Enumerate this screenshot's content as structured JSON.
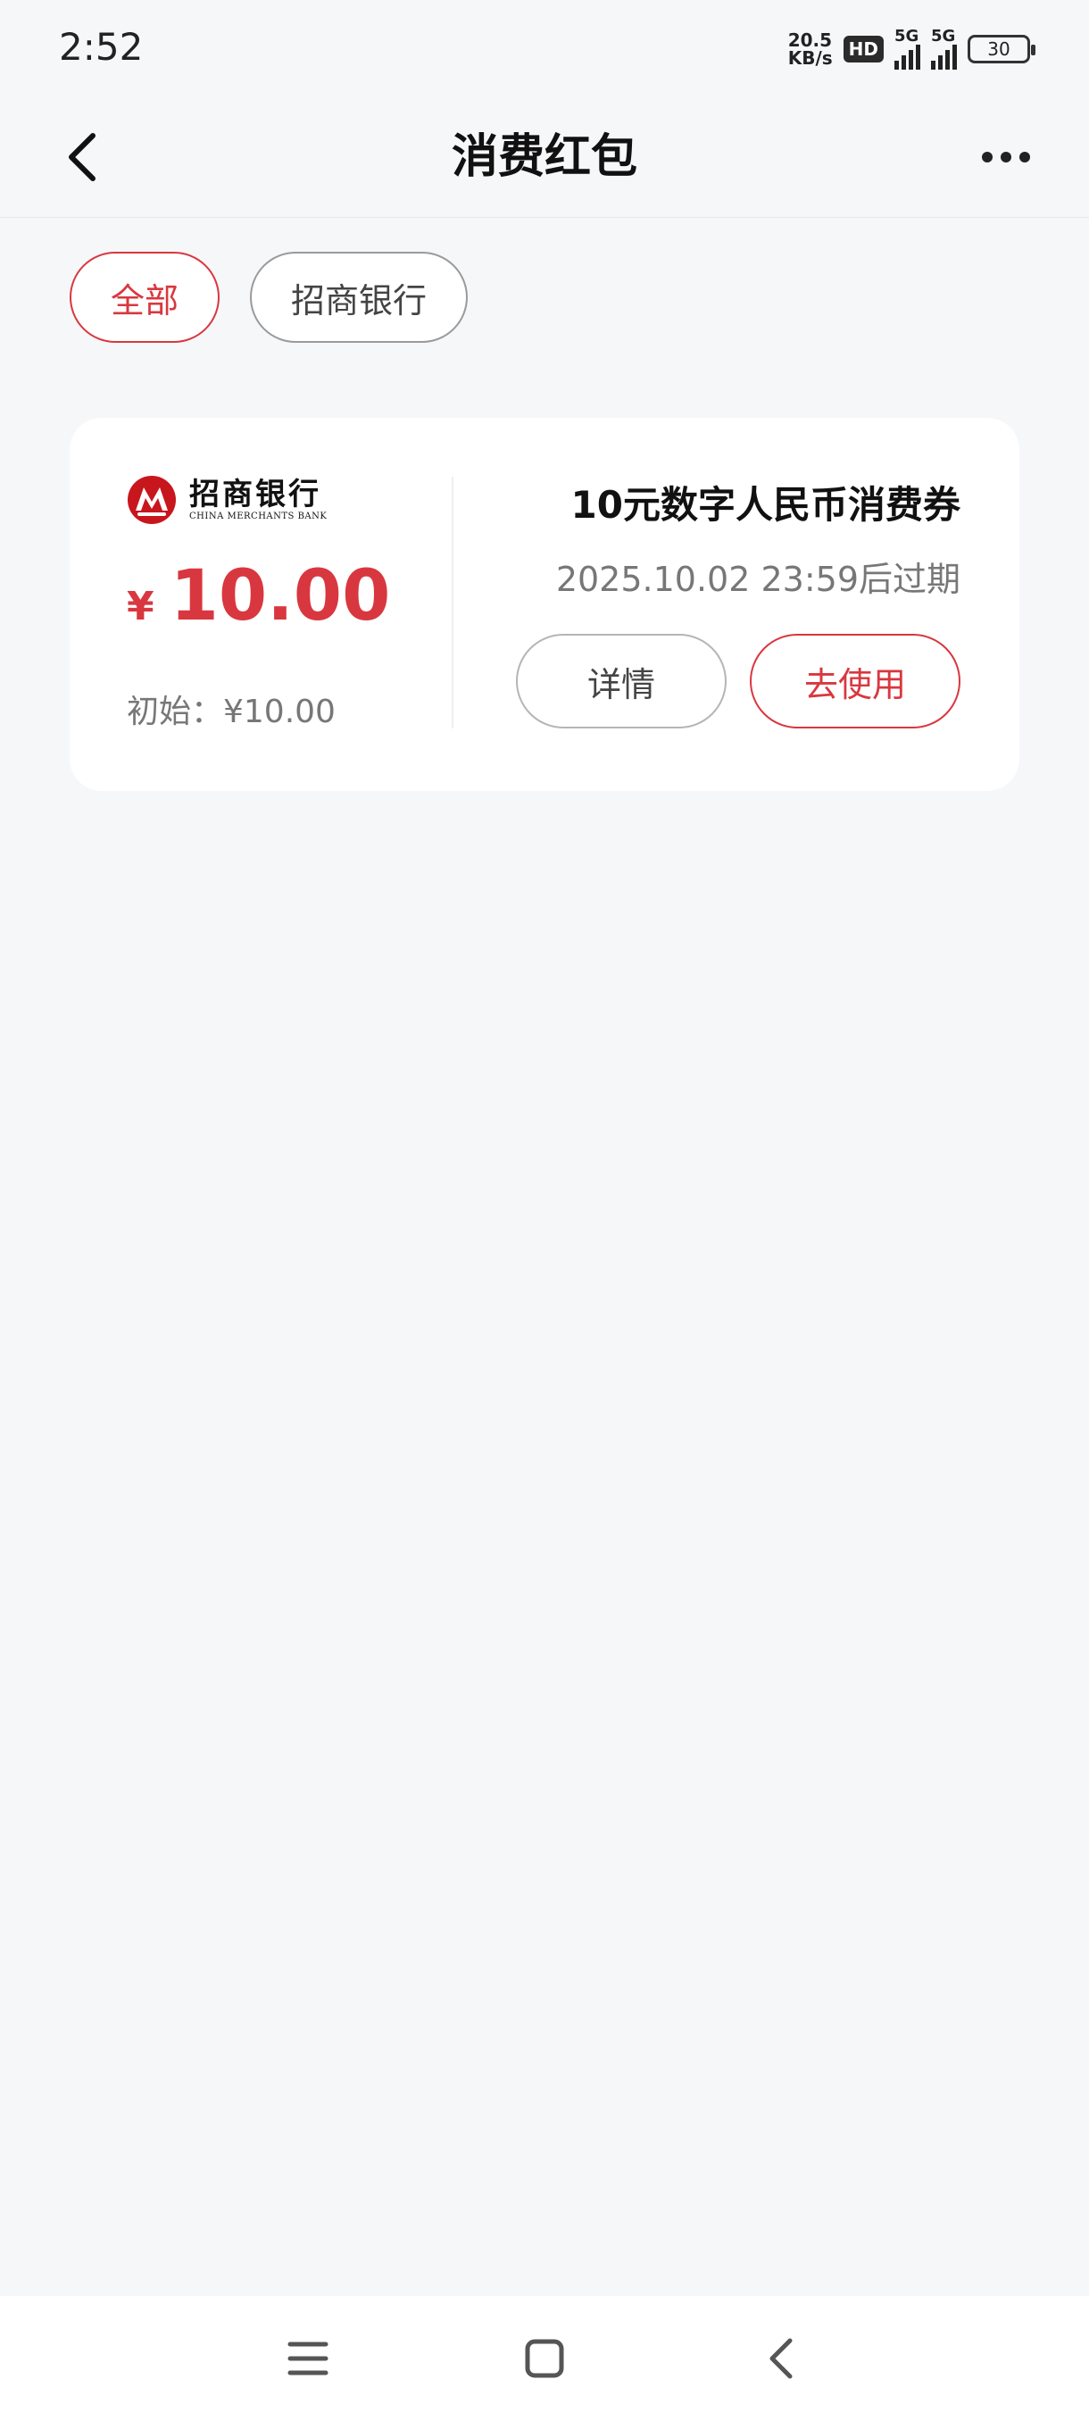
{
  "status_bar": {
    "time": "2:52",
    "net_speed_value": "20.5",
    "net_speed_unit": "KB/s",
    "hd_label": "HD",
    "signal1_label": "5G",
    "signal2_label": "5G",
    "battery_level": "30"
  },
  "header": {
    "title": "消费红包",
    "back_icon": "chevron-left-icon",
    "more_icon": "more-horizontal-icon"
  },
  "filters": [
    {
      "label": "全部",
      "active": true
    },
    {
      "label": "招商银行",
      "active": false
    }
  ],
  "coupon": {
    "bank_name": "招商银行",
    "bank_name_en": "CHINA MERCHANTS BANK",
    "currency_symbol": "¥",
    "amount": "10.00",
    "initial_text": "初始：¥10.00",
    "name": "10元数字人民币消费券",
    "expiry": "2025.10.02 23:59后过期",
    "detail_label": "详情",
    "use_label": "去使用"
  },
  "colors": {
    "accent": "#d9373f",
    "background": "#f6f7f9",
    "card": "#ffffff"
  },
  "nav_bar": {
    "menu_icon": "menu-icon",
    "home_icon": "home-square-icon",
    "back_icon": "back-chevron-icon"
  }
}
